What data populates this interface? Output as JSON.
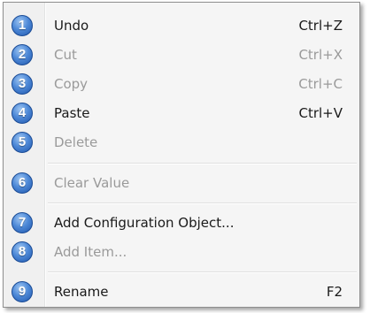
{
  "menu": {
    "items": [
      {
        "badge": "1",
        "label": "Undo",
        "shortcut": "Ctrl+Z",
        "enabled": true
      },
      {
        "badge": "2",
        "label": "Cut",
        "shortcut": "Ctrl+X",
        "enabled": false
      },
      {
        "badge": "3",
        "label": "Copy",
        "shortcut": "Ctrl+C",
        "enabled": false
      },
      {
        "badge": "4",
        "label": "Paste",
        "shortcut": "Ctrl+V",
        "enabled": true
      },
      {
        "badge": "5",
        "label": "Delete",
        "shortcut": "",
        "enabled": false
      },
      {
        "badge": "6",
        "label": "Clear Value",
        "shortcut": "",
        "enabled": false
      },
      {
        "badge": "7",
        "label": "Add Configuration Object...",
        "shortcut": "",
        "enabled": true
      },
      {
        "badge": "8",
        "label": "Add Item...",
        "shortcut": "",
        "enabled": false
      },
      {
        "badge": "9",
        "label": "Rename",
        "shortcut": "F2",
        "enabled": true
      }
    ]
  }
}
